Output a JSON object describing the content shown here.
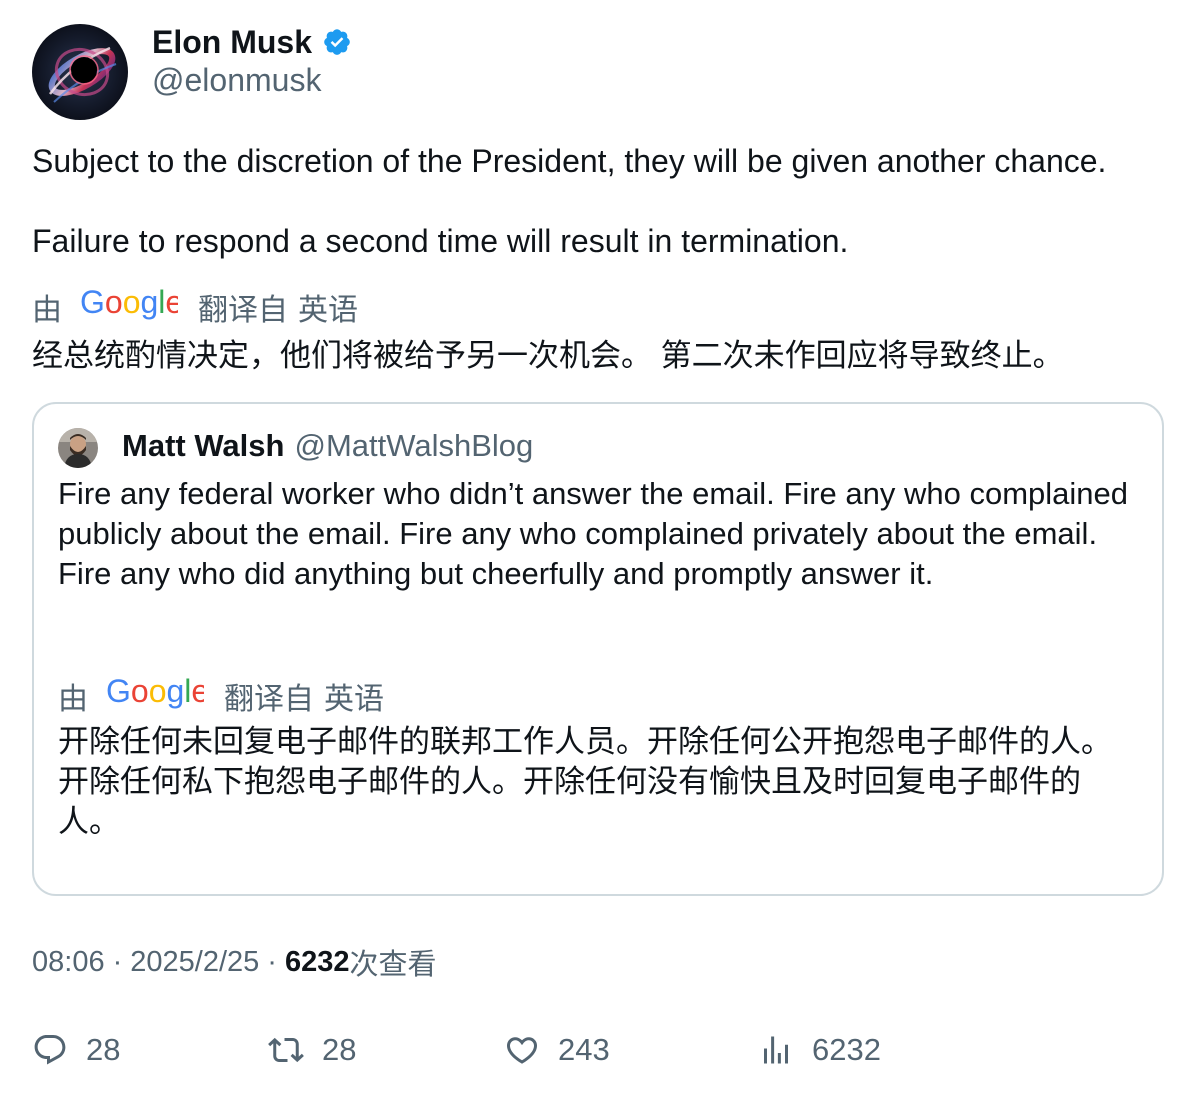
{
  "author": {
    "display_name": "Elon Musk",
    "handle": "@elonmusk",
    "verified": true,
    "avatar_icon": "black-hole-avatar"
  },
  "tweet": {
    "text_line_1": "Subject to the discretion of the President, they will be given another chance.",
    "text_line_2": "Failure to respond a second time will result in termination.",
    "translation": {
      "by_label": "由",
      "provider": "Google",
      "from_label": "翻译自",
      "language": "英语",
      "text": "经总统酌情决定，他们将被给予另一次机会。 第二次未作回应将导致终止。"
    }
  },
  "quoted_tweet": {
    "display_name": "Matt Walsh",
    "handle": "@MattWalshBlog",
    "avatar_icon": "profile-photo-avatar",
    "text": "Fire any federal worker who didn’t answer the email. Fire any who complained publicly about the email. Fire any who complained privately about the email. Fire any who did anything but cheerfully and promptly answer it.",
    "translation": {
      "by_label": "由",
      "provider": "Google",
      "from_label": "翻译自",
      "language": "英语",
      "text": "开除任何未回复电子邮件的联邦工作人员。开除任何公开抱怨电子邮件的人。开除任何私下抱怨电子邮件的人。开除任何没有愉快且及时回复电子邮件的人。"
    }
  },
  "meta": {
    "time": "08:06",
    "separator": "·",
    "date": "2025/2/25",
    "views_count": "6232",
    "views_label": "次查看"
  },
  "actions": {
    "replies": {
      "icon": "reply-icon",
      "count": "28"
    },
    "reposts": {
      "icon": "repost-icon",
      "count": "28"
    },
    "likes": {
      "icon": "like-icon",
      "count": "243"
    },
    "views": {
      "icon": "views-icon",
      "count": "6232"
    }
  },
  "colors": {
    "text_primary": "#0f1419",
    "text_secondary": "#536471",
    "verified_blue": "#1d9bf0",
    "border": "#cfd9de",
    "google_blue": "#4285F4",
    "google_red": "#EA4335",
    "google_yellow": "#FBBC05",
    "google_green": "#34A853"
  }
}
